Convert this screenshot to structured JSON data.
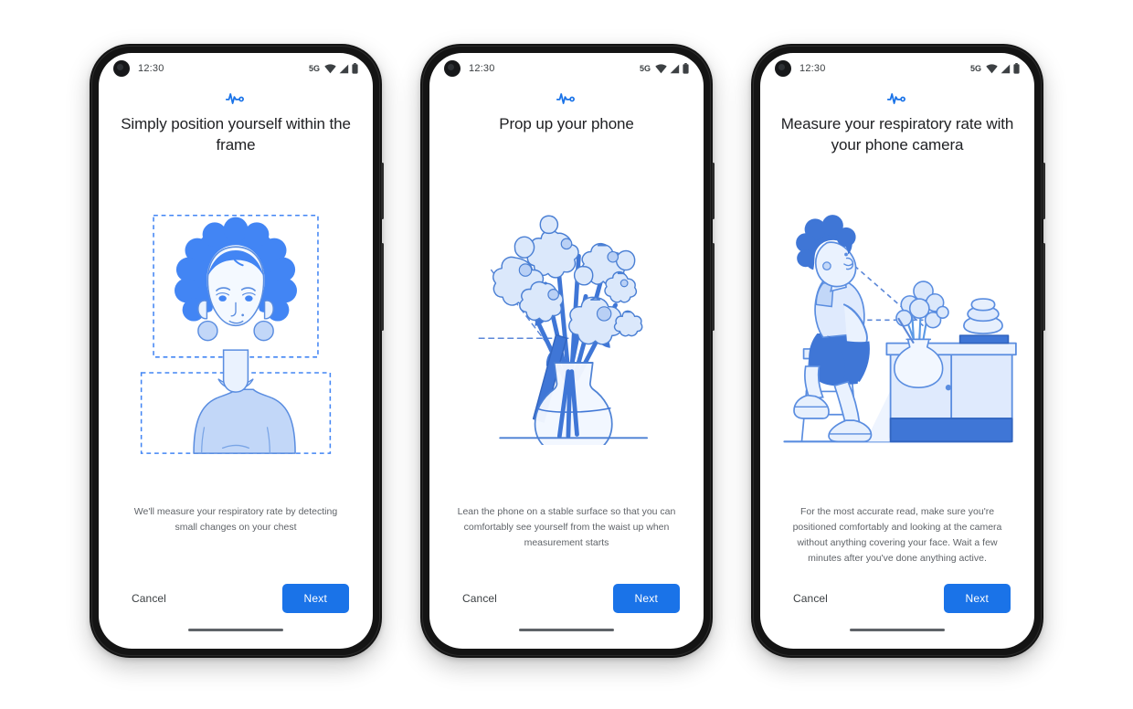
{
  "app": {
    "accent_color": "#1a73e8",
    "illustration_color": "#4285f4",
    "illustration_fill_light": "#c7d9f7",
    "background": "#ffffff"
  },
  "status_bar": {
    "time": "12:30",
    "network": "5G",
    "icons": [
      "wifi-icon",
      "cellular-signal-icon",
      "battery-icon"
    ]
  },
  "buttons": {
    "cancel_label": "Cancel",
    "next_label": "Next"
  },
  "screens": [
    {
      "id": "position-yourself",
      "brand_icon": "respiratory-pulse-icon",
      "headline": "Simply position yourself within the frame",
      "body": "We'll measure your respiratory rate by detecting small changes on your chest",
      "illustration": "person-in-frame-illustration"
    },
    {
      "id": "prop-up-phone",
      "brand_icon": "respiratory-pulse-icon",
      "headline": "Prop up your phone",
      "body": "Lean the phone on a stable surface so that you can comfortably see yourself from the waist up when measurement starts",
      "illustration": "flower-vase-with-phone-illustration"
    },
    {
      "id": "measure-respiratory-rate",
      "brand_icon": "respiratory-pulse-icon",
      "headline": "Measure your respiratory rate with your phone camera",
      "body": "For the most accurate read, make sure you're positioned comfortably and looking at the camera without anything covering your face. Wait a few minutes after you've done anything active.",
      "illustration": "person-on-stool-facing-phone-illustration"
    }
  ]
}
